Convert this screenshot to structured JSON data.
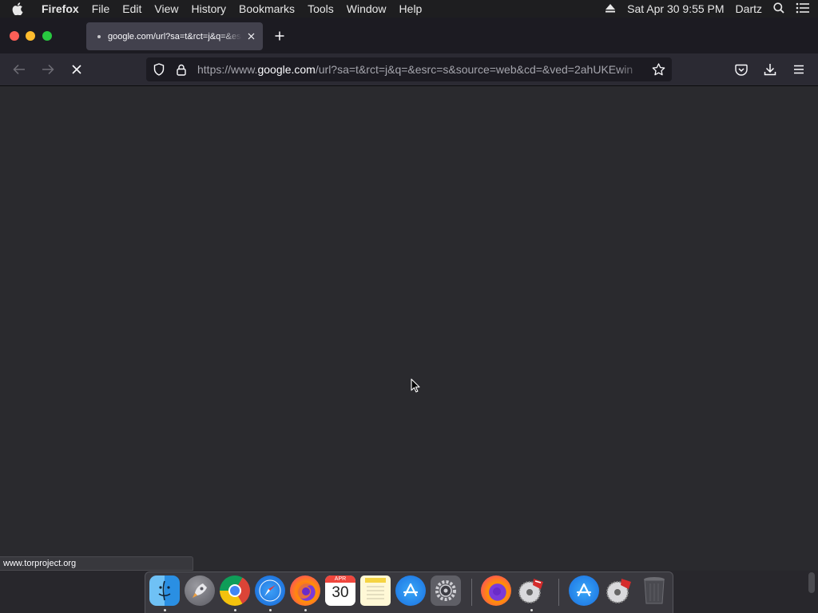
{
  "menubar": {
    "app_name": "Firefox",
    "items": [
      "File",
      "Edit",
      "View",
      "History",
      "Bookmarks",
      "Tools",
      "Window",
      "Help"
    ],
    "datetime": "Sat Apr 30  9:55 PM",
    "user": "Dartz"
  },
  "tab": {
    "title": "google.com/url?sa=t&rct=j&q=&esrc=s"
  },
  "urlbar": {
    "prefix": "https://www.",
    "host": "google.com",
    "path": "/url?sa=t&rct=j&q=&esrc=s&source=web&cd=&ved=2ahUKEwin"
  },
  "status": {
    "link": "www.torproject.org"
  },
  "dock": {
    "calendar_month": "APR",
    "calendar_day": "30",
    "apps": [
      "finder",
      "launchpad",
      "chrome",
      "safari",
      "firefox",
      "calendar",
      "notes",
      "app-store",
      "system-preferences",
      "firefox-nightly",
      "vpn-app",
      "app-store-alt",
      "vpn-app-alt",
      "trash"
    ]
  }
}
